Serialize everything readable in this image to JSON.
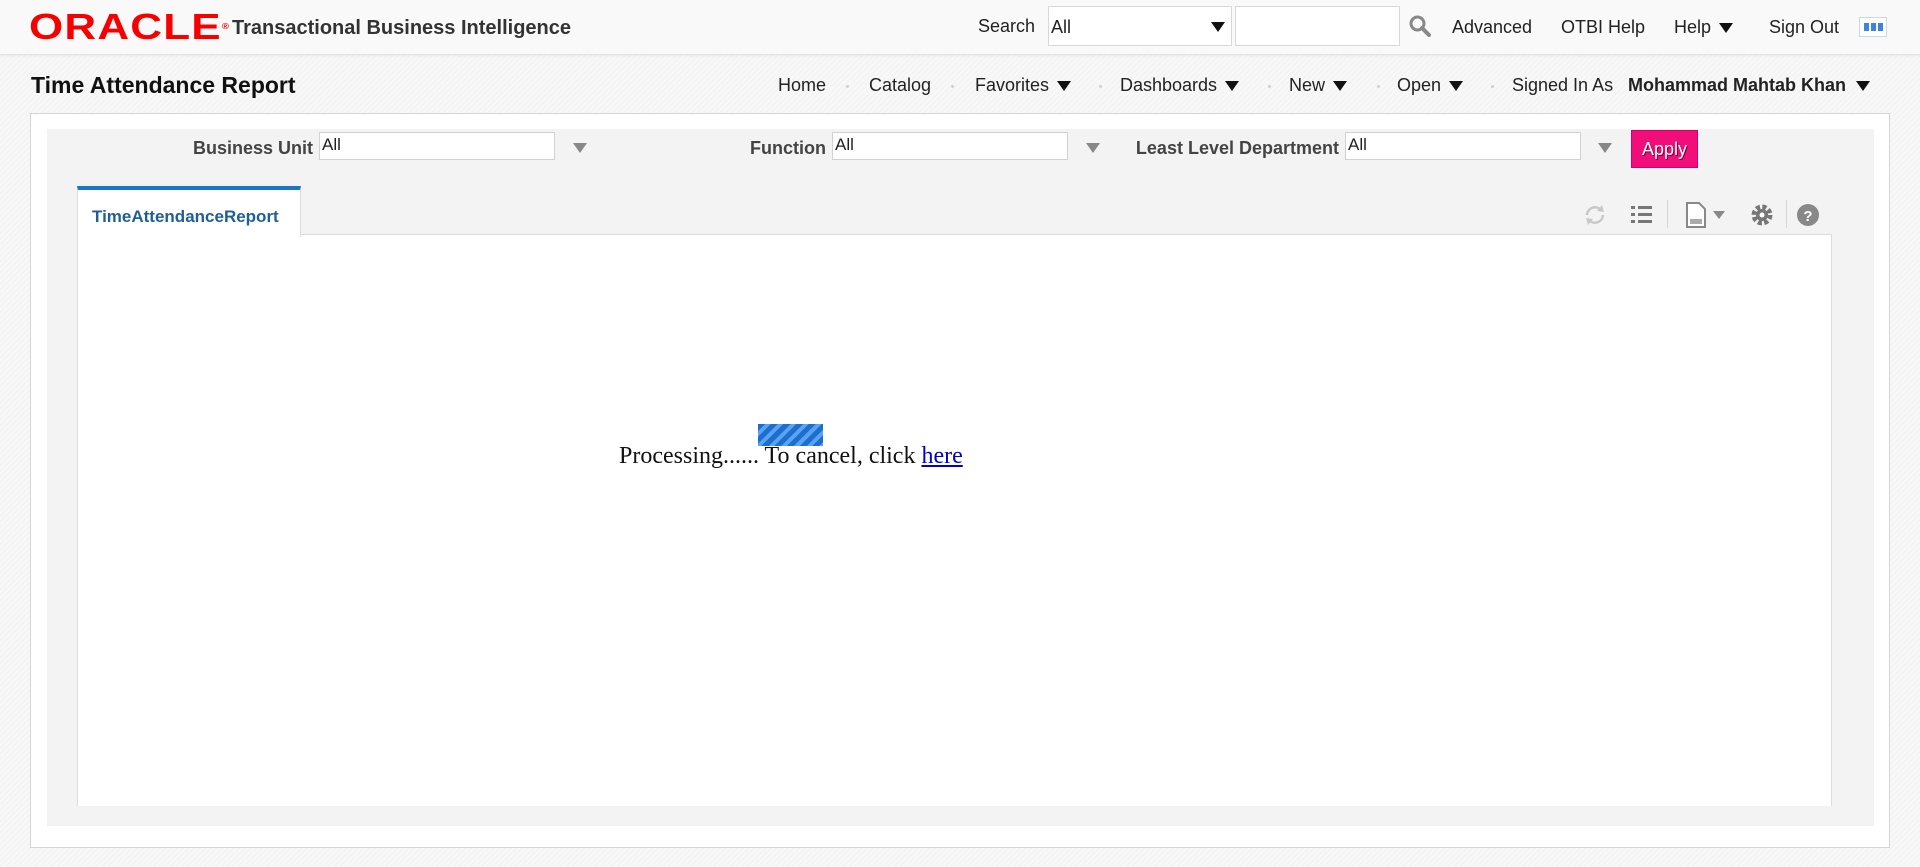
{
  "header": {
    "logo_text": "ORACLE",
    "app_name": "Transactional Business Intelligence",
    "search_label": "Search",
    "search_scope": "All",
    "search_value": "",
    "links": [
      "Advanced",
      "OTBI Help",
      "Help",
      "Sign Out"
    ]
  },
  "page": {
    "title": "Time Attendance Report",
    "nav": [
      "Home",
      "Catalog",
      "Favorites",
      "Dashboards",
      "New",
      "Open"
    ],
    "signed_in_label": "Signed In As",
    "user_name": "Mohammad Mahtab Khan"
  },
  "prompts": [
    {
      "label": "Business Unit",
      "value": "All"
    },
    {
      "label": "Function",
      "value": "All"
    },
    {
      "label": "Least Level Department",
      "value": "All"
    }
  ],
  "apply_label": "Apply",
  "tab_label": "TimeAttendanceReport",
  "processing": {
    "text": "Processing...... To cancel, click ",
    "link": "here"
  },
  "icons": [
    "search-icon",
    "navigator-icon",
    "refresh-icon",
    "list-icon",
    "export-icon",
    "gear-icon",
    "help-icon"
  ],
  "colors": {
    "oracle_red": "#f80000",
    "apply": "#f10e7a",
    "tab_accent": "#1877c5",
    "link": "#0000cc"
  }
}
